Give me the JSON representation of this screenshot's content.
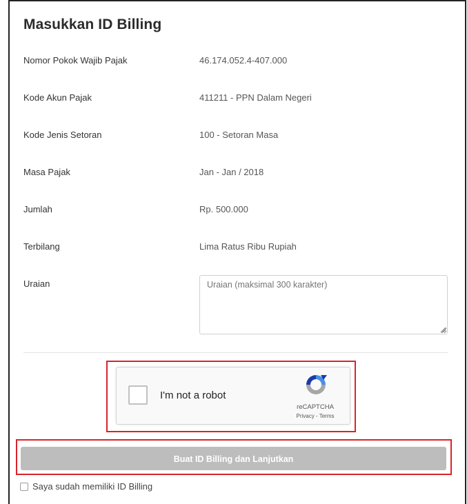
{
  "form": {
    "title": "Masukkan ID Billing",
    "rows": [
      {
        "label": "Nomor Pokok Wajib Pajak",
        "value": "46.174.052.4-407.000"
      },
      {
        "label": "Kode Akun Pajak",
        "value": "411211 - PPN Dalam Negeri"
      },
      {
        "label": "Kode Jenis Setoran",
        "value": "100 - Setoran Masa"
      },
      {
        "label": "Masa Pajak",
        "value": "Jan - Jan / 2018"
      },
      {
        "label": "Jumlah",
        "value": "Rp. 500.000"
      },
      {
        "label": "Terbilang",
        "value": "Lima Ratus Ribu Rupiah"
      }
    ],
    "uraian": {
      "label": "Uraian",
      "placeholder": "Uraian (maksimal 300 karakter)",
      "value": ""
    }
  },
  "captcha": {
    "text": "I'm not a robot",
    "brand": "reCAPTCHA",
    "privacy": "Privacy",
    "separator": " - ",
    "terms": "Terms",
    "checked": false
  },
  "actions": {
    "submit_label": "Buat ID Billing dan Lanjutkan",
    "have_id_label": "Saya sudah memiliki ID Billing",
    "have_id_checked": false
  },
  "colors": {
    "highlight_border": "#d8232a",
    "button_disabled_bg": "#bdbdbd",
    "button_text": "#ffffff"
  },
  "icons": {
    "captcha_logo": "recaptcha-logo-icon",
    "resize_grip": "resize-grip-icon"
  }
}
